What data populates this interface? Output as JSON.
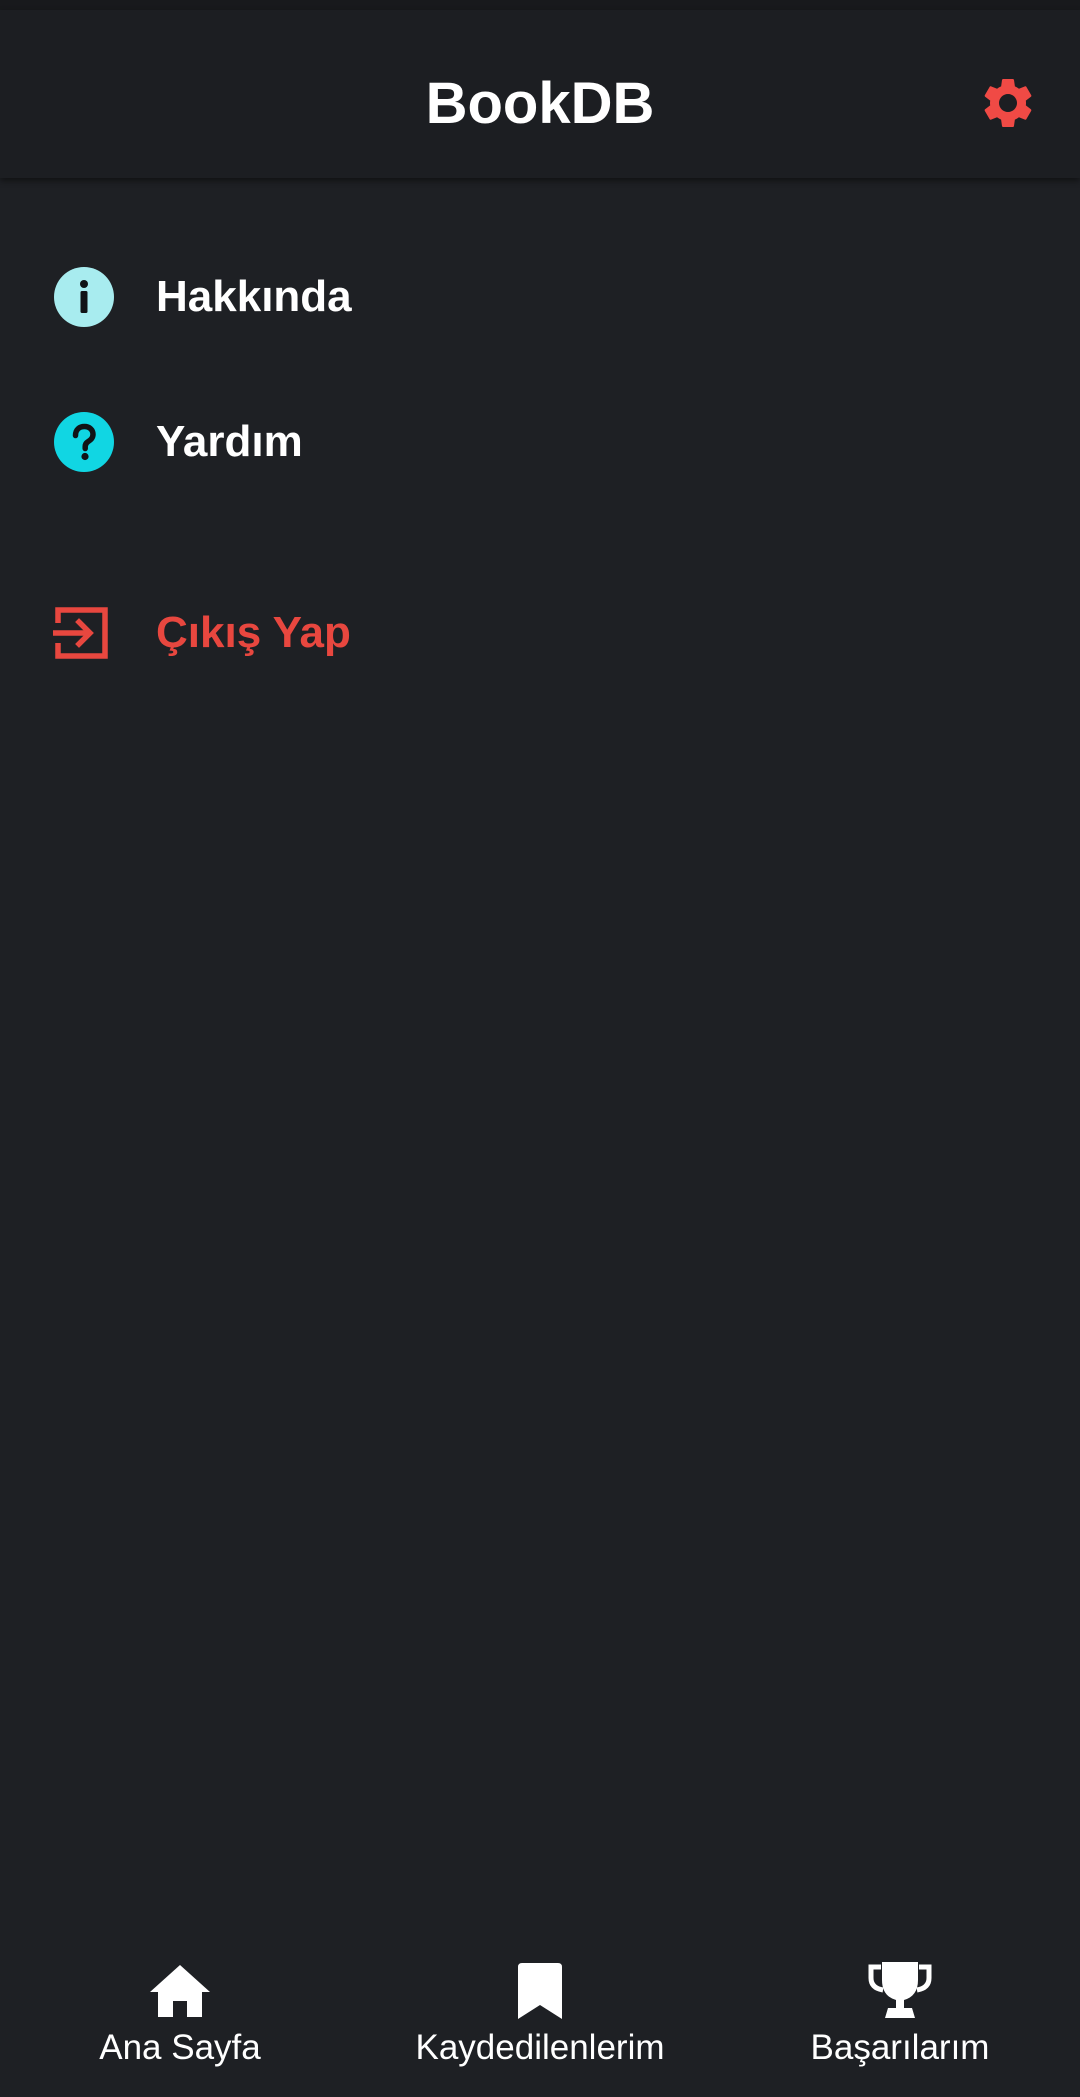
{
  "app_bar": {
    "title": "BookDB",
    "settings_icon": "gear-icon",
    "accent_color": "#f04a45"
  },
  "menu": {
    "items": [
      {
        "label": "Hakkında",
        "icon": "info-icon",
        "icon_color": "#a8ecef"
      },
      {
        "label": "Yardım",
        "icon": "help-icon",
        "icon_color": "#11d6e3"
      }
    ],
    "logout": {
      "label": "Çıkış Yap",
      "icon": "logout-icon",
      "color": "#e8473f"
    }
  },
  "bottom_nav": {
    "items": [
      {
        "label": "Ana Sayfa",
        "icon": "home-icon"
      },
      {
        "label": "Kaydedilenlerim",
        "icon": "bookmark-icon"
      },
      {
        "label": "Başarılarım",
        "icon": "trophy-icon"
      }
    ]
  }
}
